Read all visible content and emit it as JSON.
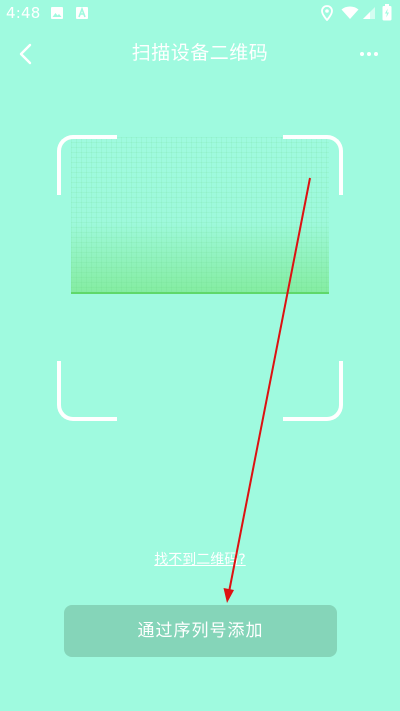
{
  "status_bar": {
    "time": "4:48",
    "left_icons": [
      "image-icon",
      "text-a-icon"
    ],
    "right_icons": [
      "location-icon",
      "wifi-icon",
      "signal-icon",
      "battery-icon"
    ]
  },
  "header": {
    "title": "扫描设备二维码",
    "back_icon": "chevron-left-icon",
    "more_icon": "more-horizontal-icon"
  },
  "scanner": {
    "frame_color": "#ffffff",
    "scan_line_color": "#5fd86a"
  },
  "help_link": {
    "label": "找不到二维码?"
  },
  "primary_action": {
    "label": "通过序列号添加"
  },
  "colors": {
    "background": "#9ffadf",
    "button": "#85d5b9",
    "annotation_arrow": "#dd1111"
  }
}
